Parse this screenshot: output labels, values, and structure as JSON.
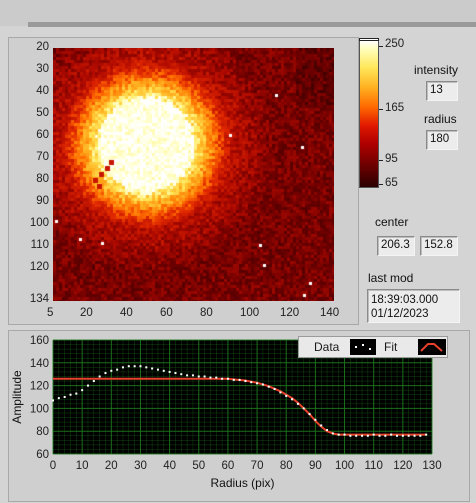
{
  "image_panel": {
    "y_ticks": [
      "20",
      "30",
      "40",
      "50",
      "60",
      "70",
      "80",
      "90",
      "100",
      "110",
      "120",
      "134"
    ],
    "x_ticks": [
      "5",
      "20",
      "40",
      "60",
      "80",
      "100",
      "120",
      "140"
    ]
  },
  "colorbar": {
    "ticks": [
      "250",
      "165",
      "95",
      "65"
    ],
    "colors": [
      "#ffffff",
      "#ffe85a",
      "#ff6a00",
      "#b00000",
      "#2a0000"
    ]
  },
  "controls": {
    "intensity_label": "intensity",
    "intensity_value": "13",
    "radius_label": "radius",
    "radius_value": "180",
    "center_label": "center",
    "center_x": "206.3",
    "center_y": "152.8",
    "lastmod_label": "last mod",
    "lastmod_time": "18:39:03.000",
    "lastmod_date": "01/12/2023"
  },
  "chart_data": {
    "type": "scatter",
    "xlabel": "Radius (pix)",
    "ylabel": "Amplitude",
    "xlim": [
      0,
      130
    ],
    "ylim": [
      60,
      160
    ],
    "x_ticks": [
      0,
      10,
      20,
      30,
      40,
      50,
      60,
      70,
      80,
      90,
      100,
      110,
      120,
      130
    ],
    "y_ticks": [
      60,
      80,
      100,
      120,
      140,
      160
    ],
    "grid": true,
    "legend_position": "top-right",
    "background": "#000000",
    "grid_color": "#1f7a1f",
    "series": [
      {
        "name": "Data",
        "style": "points",
        "color": "#ffffff",
        "x": [
          0,
          2,
          4,
          6,
          8,
          10,
          12,
          14,
          16,
          18,
          20,
          22,
          24,
          26,
          28,
          30,
          32,
          34,
          36,
          38,
          40,
          42,
          44,
          46,
          48,
          50,
          52,
          54,
          56,
          58,
          60,
          62,
          64,
          66,
          68,
          70,
          72,
          74,
          76,
          78,
          80,
          82,
          84,
          86,
          88,
          90,
          92,
          94,
          96,
          98,
          100,
          102,
          104,
          106,
          108,
          110,
          112,
          114,
          116,
          118,
          120,
          122,
          124,
          126,
          128
        ],
        "values": [
          107,
          109,
          110,
          112,
          113,
          116,
          120,
          124,
          128,
          131,
          133,
          134,
          136,
          137,
          137,
          137,
          136,
          135,
          134,
          133,
          132,
          131,
          130,
          129,
          129,
          128,
          128,
          127,
          127,
          126,
          126,
          125,
          125,
          124,
          123,
          122,
          121,
          119,
          117,
          114,
          111,
          108,
          104,
          100,
          95,
          90,
          85,
          81,
          78,
          77,
          77,
          76,
          76,
          76,
          76,
          77,
          76,
          76,
          77,
          76,
          76,
          76,
          76,
          76,
          77
        ]
      },
      {
        "name": "Fit",
        "style": "line",
        "color": "#e8412c",
        "x": [
          0,
          10,
          20,
          30,
          40,
          50,
          60,
          62,
          66,
          70,
          74,
          78,
          82,
          84,
          86,
          88,
          90,
          92,
          94,
          96,
          98,
          100,
          110,
          120,
          128
        ],
        "values": [
          126,
          126,
          126,
          126,
          126,
          126,
          126,
          125.5,
          124.5,
          122.5,
          119.5,
          115,
          109,
          105,
          100,
          95,
          89,
          84,
          80,
          78,
          77,
          77,
          77,
          77,
          77
        ]
      }
    ]
  }
}
